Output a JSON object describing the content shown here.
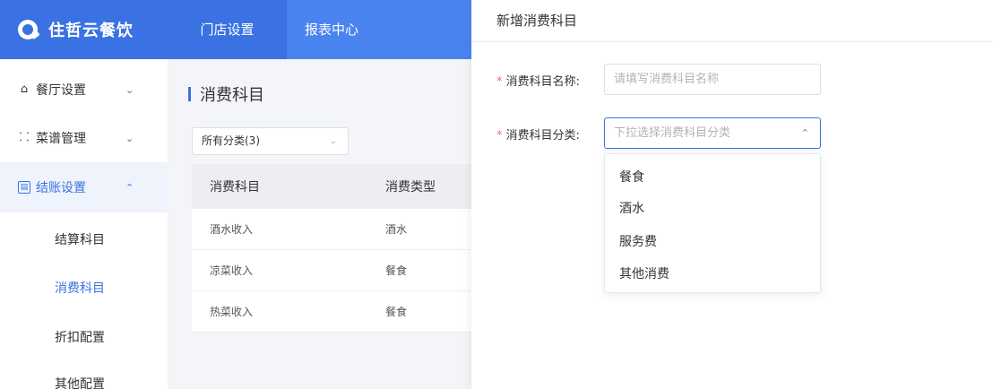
{
  "header": {
    "brand": "住哲云餐饮",
    "tabs": [
      {
        "label": "门店设置",
        "active": true
      },
      {
        "label": "报表中心",
        "active": false
      }
    ]
  },
  "sidebar": {
    "groups": [
      {
        "label": "餐厅设置",
        "icon": "home-icon",
        "expanded": false
      },
      {
        "label": "菜谱管理",
        "icon": "grid-icon",
        "expanded": false
      },
      {
        "label": "结账设置",
        "icon": "receipt-icon",
        "expanded": true
      }
    ],
    "subitems": [
      {
        "label": "结算科目",
        "active": false
      },
      {
        "label": "消费科目",
        "active": true
      },
      {
        "label": "折扣配置",
        "active": false
      },
      {
        "label": "其他配置",
        "active": false
      }
    ]
  },
  "main": {
    "title": "消费科目",
    "filter": {
      "value": "所有分类(3)"
    },
    "table": {
      "columns": [
        "消费科目",
        "消费类型"
      ],
      "rows": [
        [
          "酒水收入",
          "酒水"
        ],
        [
          "凉菜收入",
          "餐食"
        ],
        [
          "热菜收入",
          "餐食"
        ]
      ]
    }
  },
  "drawer": {
    "title": "新增消费科目",
    "fields": {
      "name": {
        "label": "消费科目名称:",
        "placeholder": "请填写消费科目名称",
        "required": true
      },
      "category": {
        "label": "消费科目分类:",
        "placeholder": "下拉选择消费科目分类",
        "required": true
      }
    },
    "dropdown_options": [
      "餐食",
      "酒水",
      "服务费",
      "其他消费"
    ]
  },
  "colors": {
    "brand": "#3a72e3",
    "topbar": "#4a84f0",
    "required": "#f56c6c"
  }
}
